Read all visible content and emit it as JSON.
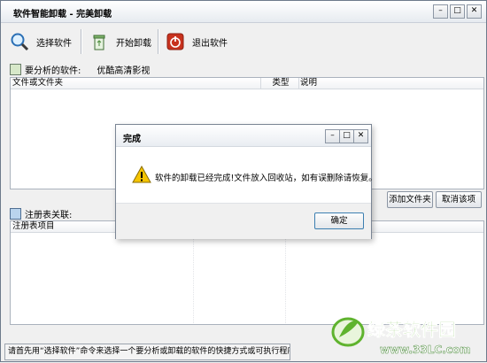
{
  "window": {
    "title": "软件智能卸载 - 完美卸载",
    "min": "–",
    "max": "□",
    "close": "✕"
  },
  "toolbar": {
    "select": "选择软件",
    "start": "开始卸载",
    "exit": "退出软件"
  },
  "analysis": {
    "label": "要分析的软件:",
    "value": "优酷高清影视"
  },
  "files_list": {
    "col_name": "文件或文件夹",
    "col_type": "类型",
    "col_desc": "说明"
  },
  "buttons": {
    "add_folder": "添加文件夹",
    "cancel_item": "取消该项"
  },
  "registry": {
    "label": "注册表关联:",
    "col_item": "注册表项目"
  },
  "status": "请首先用“选择软件”命令来选择一个要分析或卸载的软件的快捷方式或可执行程序。",
  "dialog": {
    "title": "完成",
    "message": "软件的卸载已经完成!文件放入回收站，如有误删除请恢复。",
    "ok": "确定",
    "min": "–",
    "max": "□",
    "close": "✕"
  },
  "watermark": {
    "brand": "绿茶软件园",
    "url": "www.33LC.com"
  },
  "colors": {
    "accent_green": "#5fb32e",
    "stop_red": "#c8321e",
    "warning_yellow": "#f5c400"
  }
}
